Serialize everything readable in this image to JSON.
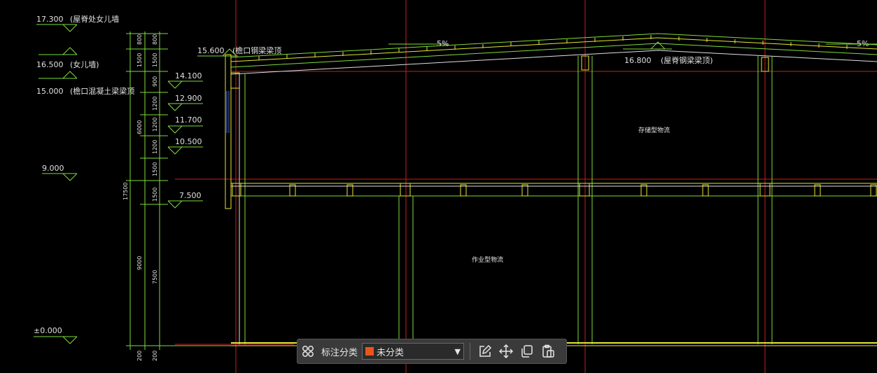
{
  "colors": {
    "bg": "#000000",
    "grid_red": "#c81e1e",
    "line_green": "#7ddc3c",
    "line_yellow": "#e6e632",
    "line_white": "#e0e0e0",
    "line_blue": "#4a6ad8",
    "accent_orange": "#e8561c"
  },
  "elevations": {
    "left": [
      {
        "value": "17.300",
        "note": "(屋脊处女儿墙"
      },
      {
        "value": "16.500",
        "note": "(女儿墙)"
      },
      {
        "value": "15.000",
        "note": "(檐口混凝土梁梁顶"
      },
      {
        "value": "9.000",
        "note": ""
      },
      {
        "value": "±0.000",
        "note": ""
      }
    ],
    "right": [
      "14.100",
      "12.900",
      "11.700",
      "10.500",
      "7.500"
    ],
    "eave": {
      "value": "15.600",
      "note": "(檐口钢梁梁顶"
    },
    "ridge": {
      "value": "16.800",
      "note": "(屋脊钢梁梁顶)"
    },
    "slope_left": "5%",
    "slope_right": "5%"
  },
  "dimensions": {
    "outer": [
      "800",
      "1500",
      "6000",
      "17500",
      "9000",
      "200"
    ],
    "inner": [
      "800",
      "1500",
      "900",
      "1200",
      "1200",
      "1200",
      "1500",
      "1500",
      "7500",
      "200"
    ]
  },
  "rooms": {
    "upper": "存储型物流",
    "lower": "作业型物流"
  },
  "toolbar": {
    "label": "标注分类",
    "selected": "未分类"
  }
}
